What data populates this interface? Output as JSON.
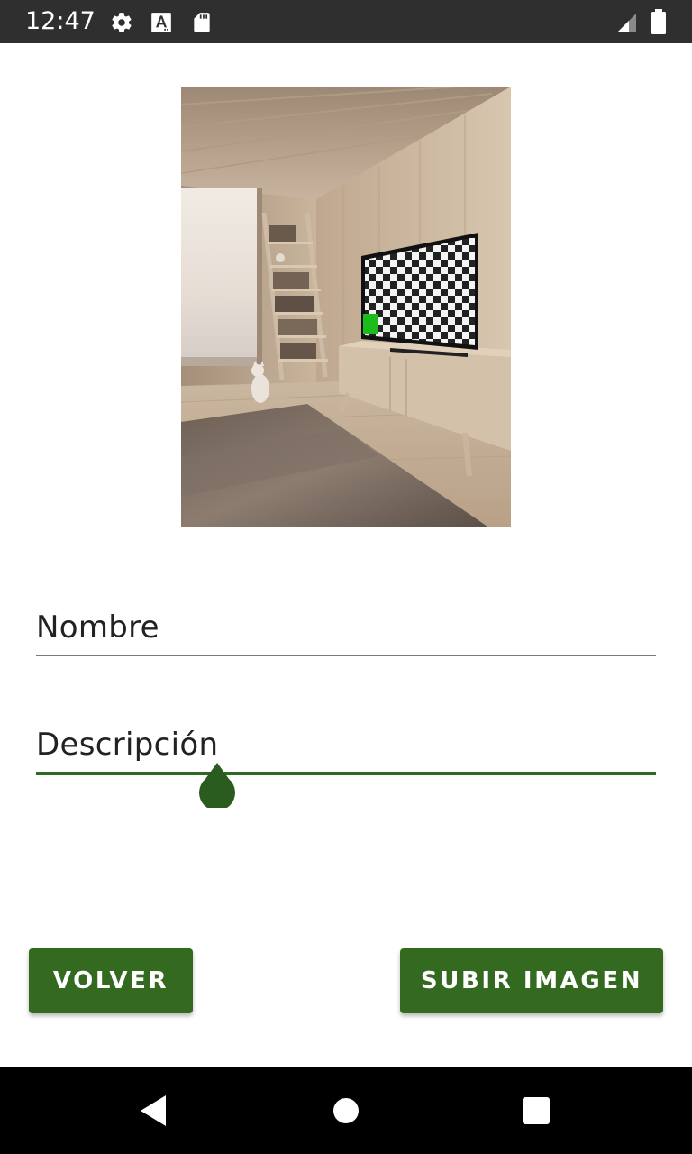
{
  "status_bar": {
    "time": "12:47",
    "icons": [
      "gear-icon",
      "font-a-icon",
      "sd-card-icon",
      "signal-icon",
      "battery-icon"
    ]
  },
  "preview": {
    "description_icon": "room-photo"
  },
  "form": {
    "nombre_label": "Nombre",
    "descripcion_label": "Descripción"
  },
  "buttons": {
    "volver_label": "VOLVER",
    "subir_label": "SUBIR IMAGEN"
  },
  "colors": {
    "accent": "#336a20",
    "status_bar": "#2f2f2f",
    "nav_bar": "#000000"
  },
  "nav_bar": {
    "icons": [
      "back-icon",
      "home-icon",
      "recents-icon"
    ]
  }
}
